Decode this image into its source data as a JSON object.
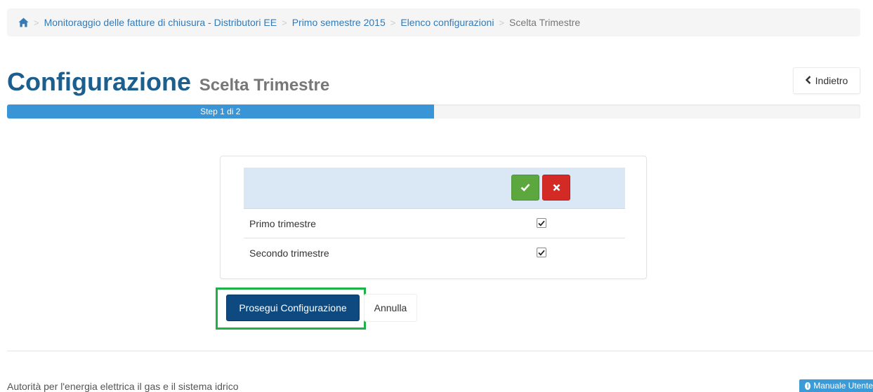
{
  "breadcrumb": {
    "home_icon": "home-icon",
    "separator": ">",
    "items": [
      {
        "label": "Monitoraggio delle fatture di chiusura - Distributori EE"
      },
      {
        "label": "Primo semestre 2015"
      },
      {
        "label": "Elenco configurazioni"
      }
    ],
    "current": "Scelta Trimestre"
  },
  "header": {
    "title": "Configurazione",
    "subtitle": "Scelta Trimestre",
    "back_label": "Indietro",
    "back_icon": "chevron-left-icon"
  },
  "progress": {
    "label": "Step 1 di 2",
    "value": 0.5,
    "color": "#3a95d6"
  },
  "selection_table": {
    "select_all_icon": "check-icon",
    "deselect_all_icon": "times-icon",
    "rows": [
      {
        "label": "Primo trimestre",
        "checked": true
      },
      {
        "label": "Secondo trimestre",
        "checked": true
      }
    ]
  },
  "actions": {
    "continue_label": "Prosegui Configurazione",
    "cancel_label": "Annulla"
  },
  "footer": {
    "text": "Autorità per l'energia elettrica il gas e il sistema idrico",
    "manual_label": "Manuale Utente",
    "manual_icon": "info-circle-icon"
  },
  "colors": {
    "link": "#337ab7",
    "title": "#1c5f8e",
    "primary": "#0e4a80",
    "success": "#5da83e",
    "danger": "#d42a25",
    "highlight": "#20b04a"
  }
}
